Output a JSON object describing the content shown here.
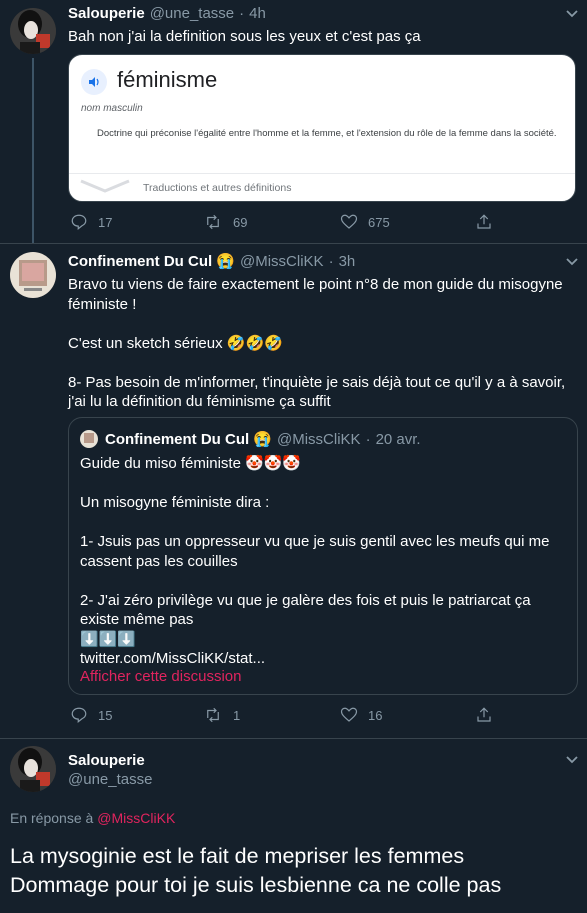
{
  "tweet1": {
    "name": "Salouperie",
    "handle": "@une_tasse",
    "time": "4h",
    "text": "Bah non j'ai la definition sous les yeux et c'est pas ça",
    "card": {
      "word": "féminisme",
      "pos": "nom masculin",
      "definition": "Doctrine qui préconise l'égalité entre l'homme et la femme, et l'extension du rôle de la femme dans la société.",
      "footer": "Traductions et autres définitions"
    },
    "replies": "17",
    "retweets": "69",
    "likes": "675"
  },
  "tweet2": {
    "name": "Confinement Du Cul 😭",
    "handle": "@MissCliKK",
    "time": "3h",
    "text": "Bravo tu viens de faire exactement le point n°8 de mon guide du misogyne féministe !\n\nC'est un sketch sérieux 🤣🤣🤣\n\n8- Pas besoin de m'informer, t'inquiète je sais déjà tout ce qu'il y a à savoir, j'ai lu la définition du féminisme ça suffit",
    "quote": {
      "name": "Confinement Du Cul 😭",
      "handle": "@MissCliKK",
      "time": "20 avr.",
      "text": "Guide du miso féministe 🤡🤡🤡\n\nUn misogyne féministe dira :\n\n1- Jsuis pas un oppresseur vu que je suis gentil avec les meufs qui me cassent pas les couilles\n\n2- J'ai zéro privilège vu que je galère des fois et puis le patriarcat ça existe même pas\n⬇️⬇️⬇️\ntwitter.com/MissCliKK/stat...",
      "show_thread": "Afficher cette discussion"
    },
    "replies": "15",
    "retweets": "1",
    "likes": "16"
  },
  "tweet3": {
    "name": "Salouperie",
    "handle": "@une_tasse",
    "reply_prefix": "En réponse à",
    "reply_to": "@MissCliKK",
    "text": "La mysoginie est le fait de mepriser les femmes\nDommage pour toi je suis lesbienne ca ne colle pas"
  },
  "icons": {
    "reply": "reply-icon",
    "retweet": "retweet-icon",
    "like": "heart-icon",
    "share": "share-icon",
    "more": "chevron-down-icon",
    "speaker": "speaker-icon"
  },
  "colors": {
    "background": "#15202b",
    "muted": "#8899a6",
    "link": "#e0245e",
    "border": "#38444d"
  }
}
